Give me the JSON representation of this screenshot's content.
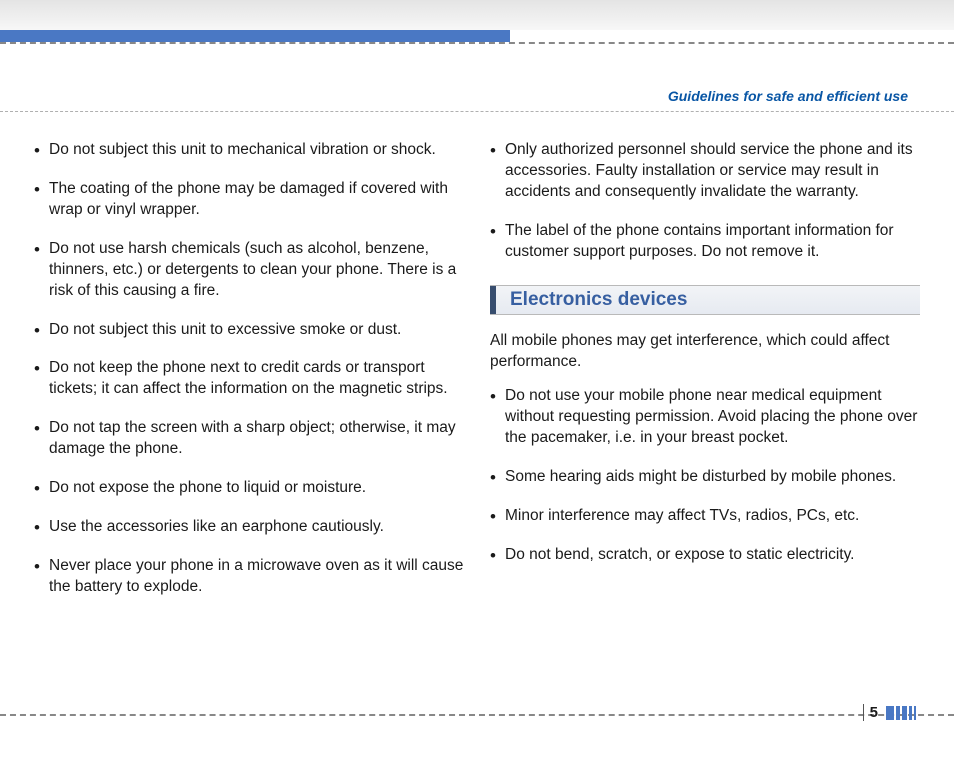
{
  "header": {
    "section_title": "Guidelines for safe and efficient use"
  },
  "leftColumn": {
    "bullets": [
      "Do not subject this unit to mechanical vibration or shock.",
      "The coating of the phone may be damaged if covered with wrap or vinyl wrapper.",
      "Do not use harsh chemicals (such as alcohol, benzene, thinners, etc.) or detergents to clean your phone. There is a risk of this causing a fire.",
      "Do not subject this unit to excessive smoke or dust.",
      "Do not keep the phone next to credit cards or transport tickets; it can affect the information on the magnetic strips.",
      "Do not tap the screen with a sharp object; otherwise, it may damage the phone.",
      "Do not expose the phone to liquid or moisture.",
      "Use the accessories like an earphone cautiously.",
      "Never place your phone in a microwave oven as it will cause the battery to explode."
    ]
  },
  "rightColumn": {
    "topBullets": [
      "Only authorized personnel should service the phone and its accessories. Faulty installation or service may result in accidents and consequently invalidate the warranty.",
      "The label of the phone contains important information for customer support purposes. Do not remove it."
    ],
    "sectionHeading": "Electronics devices",
    "intro": "All mobile phones may get interference, which could affect performance.",
    "electronicsBullets": [
      "Do not use your mobile phone near medical equipment without requesting permission. Avoid placing the phone over the pacemaker, i.e. in your breast pocket.",
      "Some hearing aids might be disturbed by mobile phones.",
      "Minor interference may affect TVs, radios, PCs, etc.",
      "Do not bend, scratch, or expose to static electricity."
    ]
  },
  "footer": {
    "pageNumber": "5"
  }
}
